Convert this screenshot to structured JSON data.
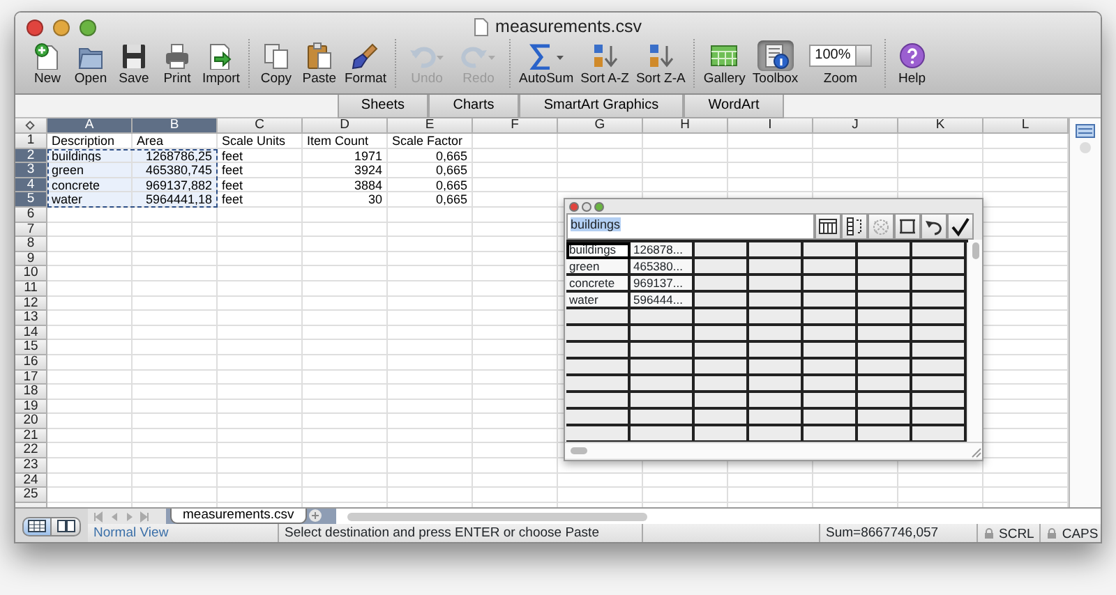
{
  "window": {
    "title": "measurements.csv"
  },
  "toolbar": {
    "groups": [
      {
        "items": [
          {
            "label": "New",
            "kind": "new",
            "disabled": false,
            "active": false
          },
          {
            "label": "Open",
            "kind": "open",
            "disabled": false,
            "active": false
          },
          {
            "label": "Save",
            "kind": "save",
            "disabled": false,
            "active": false
          },
          {
            "label": "Print",
            "kind": "print",
            "disabled": false,
            "active": false
          },
          {
            "label": "Import",
            "kind": "import",
            "disabled": false,
            "active": false
          }
        ]
      },
      {
        "items": [
          {
            "label": "Copy",
            "kind": "copy",
            "disabled": false,
            "active": false
          },
          {
            "label": "Paste",
            "kind": "paste",
            "disabled": false,
            "active": false
          },
          {
            "label": "Format",
            "kind": "format",
            "disabled": false,
            "active": false
          }
        ]
      },
      {
        "items": [
          {
            "label": "Undo",
            "kind": "undo",
            "disabled": true,
            "active": false
          },
          {
            "label": "Redo",
            "kind": "redo",
            "disabled": true,
            "active": false
          }
        ]
      },
      {
        "items": [
          {
            "label": "AutoSum",
            "kind": "autosum",
            "disabled": false,
            "active": false
          },
          {
            "label": "Sort A-Z",
            "kind": "sortaz",
            "disabled": false,
            "active": false
          },
          {
            "label": "Sort Z-A",
            "kind": "sortza",
            "disabled": false,
            "active": false
          }
        ]
      },
      {
        "items": [
          {
            "label": "Gallery",
            "kind": "gallery",
            "disabled": false,
            "active": false
          },
          {
            "label": "Toolbox",
            "kind": "toolbox",
            "disabled": false,
            "active": true
          },
          {
            "label": "Zoom",
            "kind": "zoom",
            "value": "100%",
            "disabled": false,
            "active": false
          }
        ]
      },
      {
        "items": [
          {
            "label": "Help",
            "kind": "help",
            "disabled": false,
            "active": false
          }
        ]
      }
    ]
  },
  "ribbon_tabs": [
    "Sheets",
    "Charts",
    "SmartArt Graphics",
    "WordArt"
  ],
  "sheet": {
    "copy_marquee": true,
    "columns": [
      {
        "letter": "A",
        "selected": true,
        "numeric": false
      },
      {
        "letter": "B",
        "selected": true,
        "numeric": true
      },
      {
        "letter": "C",
        "selected": false,
        "numeric": false
      },
      {
        "letter": "D",
        "selected": false,
        "numeric": true
      },
      {
        "letter": "E",
        "selected": false,
        "numeric": true
      },
      {
        "letter": "F",
        "selected": false
      },
      {
        "letter": "G",
        "selected": false
      },
      {
        "letter": "H",
        "selected": false
      },
      {
        "letter": "I",
        "selected": false
      },
      {
        "letter": "J",
        "selected": false
      },
      {
        "letter": "K",
        "selected": false
      },
      {
        "letter": "L",
        "selected": false
      }
    ],
    "rows": [
      {
        "number": "1",
        "kind": "header",
        "selected": false,
        "cells": [
          "Description",
          "Area",
          "Scale Units",
          "Item Count",
          "Scale Factor"
        ]
      },
      {
        "number": "2",
        "kind": "data",
        "selected": true,
        "cells": [
          "buildings",
          "1268786,25",
          "feet",
          "1971",
          "0,665"
        ]
      },
      {
        "number": "3",
        "kind": "data",
        "selected": true,
        "cells": [
          "green",
          "465380,745",
          "feet",
          "3924",
          "0,665"
        ]
      },
      {
        "number": "4",
        "kind": "data",
        "selected": true,
        "cells": [
          "concrete",
          "969137,882",
          "feet",
          "3884",
          "0,665"
        ]
      },
      {
        "number": "5",
        "kind": "data",
        "selected": true,
        "cells": [
          "water",
          "5964441,18",
          "feet",
          "30",
          "0,665"
        ]
      },
      {
        "number": "6",
        "kind": "data",
        "selected": false
      },
      {
        "number": "7",
        "kind": "data",
        "selected": false
      },
      {
        "number": "8",
        "kind": "data",
        "selected": false
      },
      {
        "number": "9",
        "kind": "data",
        "selected": false
      },
      {
        "number": "10",
        "kind": "data",
        "selected": false
      },
      {
        "number": "11",
        "kind": "data",
        "selected": false
      },
      {
        "number": "12",
        "kind": "data",
        "selected": false
      },
      {
        "number": "13",
        "kind": "data",
        "selected": false
      },
      {
        "number": "14",
        "kind": "data",
        "selected": false
      },
      {
        "number": "15",
        "kind": "data",
        "selected": false
      },
      {
        "number": "16",
        "kind": "data",
        "selected": false
      },
      {
        "number": "17",
        "kind": "data",
        "selected": false
      },
      {
        "number": "18",
        "kind": "data",
        "selected": false
      },
      {
        "number": "19",
        "kind": "data",
        "selected": false
      },
      {
        "number": "20",
        "kind": "data",
        "selected": false
      },
      {
        "number": "21",
        "kind": "data",
        "selected": false
      },
      {
        "number": "22",
        "kind": "data",
        "selected": false
      },
      {
        "number": "23",
        "kind": "data",
        "selected": false
      },
      {
        "number": "24",
        "kind": "data",
        "selected": false
      },
      {
        "number": "25",
        "kind": "data",
        "selected": false
      }
    ]
  },
  "palette": {
    "field": {
      "value": "buildings",
      "highlighted": true
    },
    "buttons": [
      {
        "kind": "table"
      },
      {
        "kind": "columns"
      },
      {
        "kind": "shuffle"
      },
      {
        "kind": "rows"
      },
      {
        "kind": "undo"
      },
      {
        "kind": "check"
      }
    ],
    "rows": [
      {
        "cells": [
          {
            "text": "buildings",
            "selected": true
          },
          {
            "text": "126878...",
            "selected": false
          }
        ]
      },
      {
        "cells": [
          {
            "text": "green",
            "selected": false
          },
          {
            "text": "465380...",
            "selected": false
          }
        ]
      },
      {
        "cells": [
          {
            "text": "concrete",
            "selected": false
          },
          {
            "text": "969137...",
            "selected": false
          }
        ]
      },
      {
        "cells": [
          {
            "text": "water",
            "selected": false
          },
          {
            "text": "596444...",
            "selected": false
          }
        ]
      }
    ]
  },
  "view_buttons": [
    {
      "kind": "normal",
      "selected": true
    },
    {
      "kind": "layout",
      "selected": false
    }
  ],
  "sheet_tabs": [
    {
      "label": "measurements.csv",
      "selected": true
    }
  ],
  "status_bar": {
    "view": "Normal View",
    "message": "Select destination and press ENTER or choose Paste",
    "sum": "Sum=8667746,057",
    "indicators": [
      "SCRL",
      "CAPS"
    ]
  }
}
